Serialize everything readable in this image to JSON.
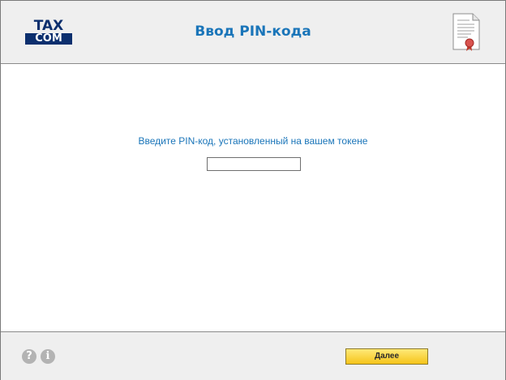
{
  "header": {
    "logo_top": "TAX",
    "logo_bottom": "COM",
    "title": "Ввод PIN-кода",
    "doc_icon": "certificate-document-icon"
  },
  "main": {
    "prompt": "Введите PIN-код, установленный на вашем токене",
    "pin_value": ""
  },
  "footer": {
    "help_icon": "?",
    "info_icon": "i",
    "next_label": "Далее"
  },
  "colors": {
    "accent": "#1a75b9",
    "logo": "#0c2f6e",
    "button": "#f5c41a"
  }
}
